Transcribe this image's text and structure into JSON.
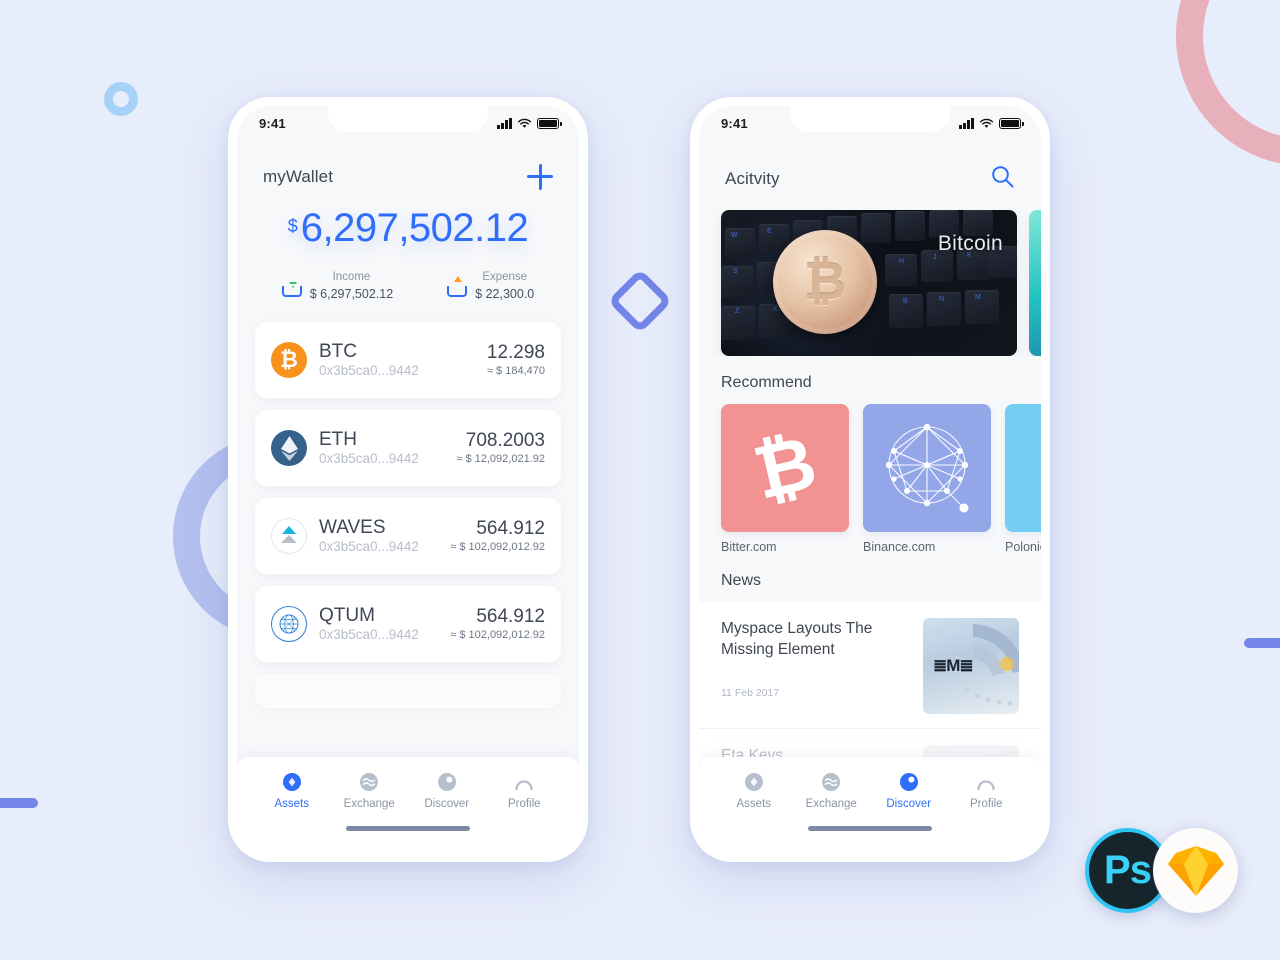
{
  "background": {
    "page_color": "#e8edfb",
    "decorations": [
      {
        "name": "ring-pink",
        "color": "#e8a8b3"
      },
      {
        "name": "ring-periwinkle",
        "color": "#b4c0ef"
      },
      {
        "name": "ring-skyblue",
        "color": "#a6d2f7"
      },
      {
        "name": "bar-left",
        "color": "#7486e8"
      },
      {
        "name": "bar-right",
        "color": "#7486e8"
      },
      {
        "name": "diamond",
        "color": "#7486e8"
      }
    ]
  },
  "logos": {
    "photoshop_label": "Ps",
    "photoshop_color": "#3ad3f7",
    "sketch_name": "sketch-gem-icon"
  },
  "phone1": {
    "status": {
      "time": "9:41",
      "signal": "signal-icon",
      "wifi": "wifi-icon",
      "battery": "battery-icon"
    },
    "header": {
      "title": "myWallet",
      "add_icon": "plus-icon"
    },
    "balance": {
      "currency": "$",
      "amount": "6,297,502.12",
      "color": "#2f6dfb"
    },
    "flows": [
      {
        "label": "Income",
        "value": "$ 6,297,502.12",
        "direction": "down",
        "arrow_color": "#28c76f"
      },
      {
        "label": "Expense",
        "value": "$ 22,300.0",
        "direction": "up",
        "arrow_color": "#ff9f1c"
      }
    ],
    "assets": [
      {
        "symbol": "BTC",
        "address": "0x3b5ca0...9442",
        "amount": "12.298",
        "fiat": "≈ $ 184,470",
        "icon": "bitcoin-icon",
        "icon_color": "#f7931a"
      },
      {
        "symbol": "ETH",
        "address": "0x3b5ca0...9442",
        "amount": "708.2003",
        "fiat": "≈ $ 12,092,021.92",
        "icon": "ethereum-icon",
        "icon_color": "#35618a"
      },
      {
        "symbol": "WAVES",
        "address": "0x3b5ca0...9442",
        "amount": "564.912",
        "fiat": "≈ $ 102,092,012.92",
        "icon": "waves-icon",
        "icon_color": "#19b5e0"
      },
      {
        "symbol": "QTUM",
        "address": "0x3b5ca0...9442",
        "amount": "564.912",
        "fiat": "≈ $ 102,092,012.92",
        "icon": "qtum-icon",
        "icon_color": "#2f7fd4"
      }
    ],
    "tabs": [
      {
        "label": "Assets",
        "icon": "assets-icon",
        "active": true
      },
      {
        "label": "Exchange",
        "icon": "exchange-icon",
        "active": false
      },
      {
        "label": "Discover",
        "icon": "discover-icon",
        "active": false
      },
      {
        "label": "Profile",
        "icon": "profile-icon",
        "active": false
      }
    ]
  },
  "phone2": {
    "status": {
      "time": "9:41",
      "signal": "signal-icon",
      "wifi": "wifi-icon",
      "battery": "battery-icon"
    },
    "header": {
      "title": "Acitvity",
      "search_icon": "search-icon"
    },
    "banners": [
      {
        "title": "Bitcoin",
        "style": "keyboard-bitcoin"
      },
      {
        "title": "",
        "style": "teal-abstract"
      }
    ],
    "recommend": {
      "title": "Recommend",
      "items": [
        {
          "label": "Bitter.com",
          "thumb": "bitcoin-glyph",
          "color": "#f39292"
        },
        {
          "label": "Binance.com",
          "thumb": "network-graph",
          "color": "#93a6e8"
        },
        {
          "label": "Polonie",
          "thumb": "poloniex-glyph",
          "color": "#74cdf2"
        }
      ]
    },
    "news": {
      "title": "News",
      "items": [
        {
          "title": "Myspace Layouts The Missing Element",
          "date": "11 Feb 2017",
          "thumb": "ibm-server-image"
        },
        {
          "title": "Eta Keys",
          "date": "",
          "thumb": "portrait-image"
        }
      ]
    },
    "tabs": [
      {
        "label": "Assets",
        "icon": "assets-icon",
        "active": false
      },
      {
        "label": "Exchange",
        "icon": "exchange-icon",
        "active": false
      },
      {
        "label": "Discover",
        "icon": "discover-icon",
        "active": true
      },
      {
        "label": "Profile",
        "icon": "profile-icon",
        "active": false
      }
    ]
  }
}
